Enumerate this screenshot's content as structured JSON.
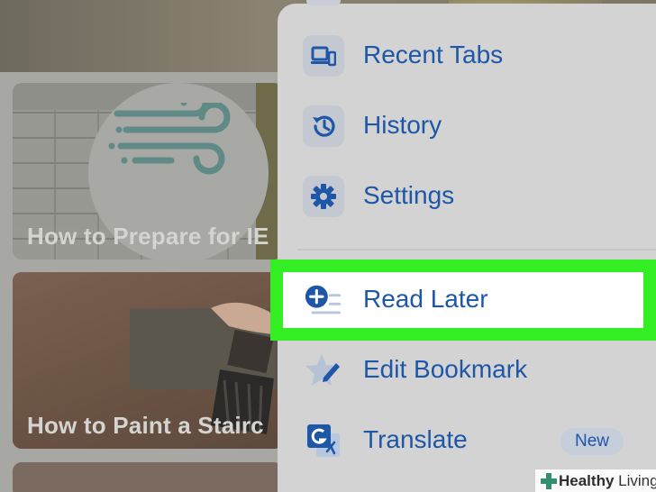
{
  "background": {
    "cards": [
      {
        "title": "How to Prepare for IE"
      },
      {
        "title": "How to Paint a Stairc"
      }
    ]
  },
  "menu": {
    "items": [
      {
        "label": "Recent Tabs",
        "icon": "recent-tabs-icon"
      },
      {
        "label": "History",
        "icon": "history-icon"
      },
      {
        "label": "Settings",
        "icon": "settings-gear-icon"
      },
      {
        "label": "Read Later",
        "icon": "read-later-plus-icon",
        "highlighted": true
      },
      {
        "label": "Edit Bookmark",
        "icon": "star-pencil-icon"
      },
      {
        "label": "Translate",
        "icon": "translate-icon",
        "badge": "New"
      }
    ]
  },
  "watermark": {
    "bold": "Healthy",
    "rest": " Living"
  },
  "colors": {
    "accent": "#1e56a8",
    "highlight": "#33ee22",
    "menu_bg": "#d3d3d3",
    "icon_bg": "#c4c9d1"
  }
}
